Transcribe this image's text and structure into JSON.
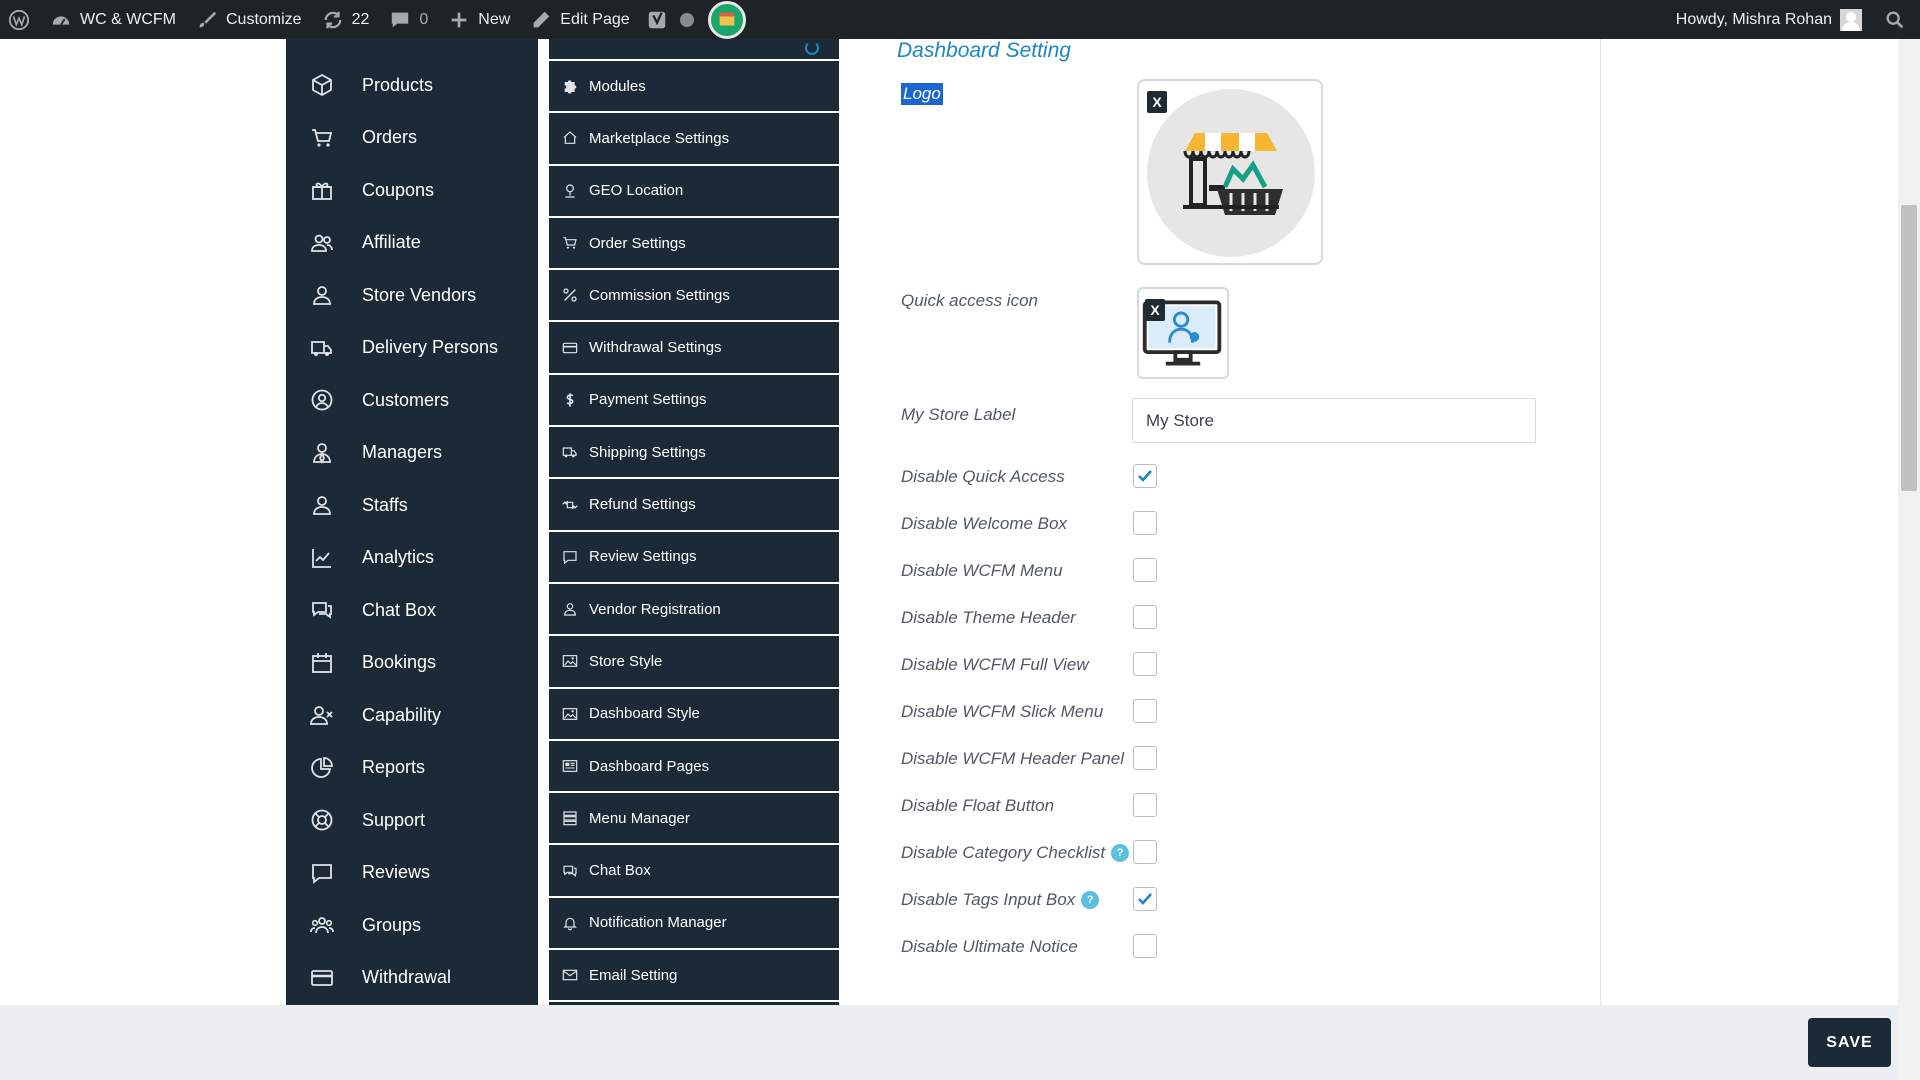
{
  "adminbar": {
    "site_name": "WC & WCFM",
    "customize": "Customize",
    "updates_count": "22",
    "comments_count": "0",
    "new_label": "New",
    "edit_page": "Edit Page",
    "greeting": "Howdy, Mishra Rohan"
  },
  "menu1": {
    "items": [
      {
        "label": "Products",
        "icon": "box-icon"
      },
      {
        "label": "Orders",
        "icon": "cart-icon"
      },
      {
        "label": "Coupons",
        "icon": "gift-icon"
      },
      {
        "label": "Affiliate",
        "icon": "users-icon"
      },
      {
        "label": "Store Vendors",
        "icon": "user-icon"
      },
      {
        "label": "Delivery Persons",
        "icon": "truck-icon"
      },
      {
        "label": "Customers",
        "icon": "user-circle-icon"
      },
      {
        "label": "Managers",
        "icon": "user-tie-icon"
      },
      {
        "label": "Staffs",
        "icon": "user-icon"
      },
      {
        "label": "Analytics",
        "icon": "chart-line-icon"
      },
      {
        "label": "Chat Box",
        "icon": "chat-icon"
      },
      {
        "label": "Bookings",
        "icon": "calendar-icon"
      },
      {
        "label": "Capability",
        "icon": "user-x-icon"
      },
      {
        "label": "Reports",
        "icon": "pie-chart-icon"
      },
      {
        "label": "Support",
        "icon": "lifebuoy-icon"
      },
      {
        "label": "Reviews",
        "icon": "comment-icon"
      },
      {
        "label": "Groups",
        "icon": "group-icon"
      },
      {
        "label": "Withdrawal",
        "icon": "credit-card-icon"
      }
    ]
  },
  "menu2": {
    "items": [
      {
        "label": "Modules",
        "icon": "puzzle-icon"
      },
      {
        "label": "Marketplace Settings",
        "icon": "home-icon"
      },
      {
        "label": "GEO Location",
        "icon": "map-marker-icon"
      },
      {
        "label": "Order Settings",
        "icon": "cart-icon"
      },
      {
        "label": "Commission Settings",
        "icon": "percent-icon"
      },
      {
        "label": "Withdrawal Settings",
        "icon": "credit-card-icon"
      },
      {
        "label": "Payment Settings",
        "icon": "dollar-icon"
      },
      {
        "label": "Shipping Settings",
        "icon": "truck-icon"
      },
      {
        "label": "Refund Settings",
        "icon": "retweet-icon"
      },
      {
        "label": "Review Settings",
        "icon": "comment-icon"
      },
      {
        "label": "Vendor Registration",
        "icon": "user-icon"
      },
      {
        "label": "Store Style",
        "icon": "image-icon"
      },
      {
        "label": "Dashboard Style",
        "icon": "image-icon"
      },
      {
        "label": "Dashboard Pages",
        "icon": "newspaper-icon"
      },
      {
        "label": "Menu Manager",
        "icon": "server-icon"
      },
      {
        "label": "Chat Box",
        "icon": "chat-icon"
      },
      {
        "label": "Notification Manager",
        "icon": "bell-icon"
      },
      {
        "label": "Email Setting",
        "icon": "envelope-icon"
      }
    ]
  },
  "content": {
    "title": "Dashboard Setting",
    "logo_label": "Logo",
    "quick_access_label": "Quick access icon",
    "store_label": "My Store Label",
    "store_value": "My Store",
    "remove_label": "X",
    "checkboxes": [
      {
        "label": "Disable Quick Access",
        "checked": true
      },
      {
        "label": "Disable Welcome Box",
        "checked": false
      },
      {
        "label": "Disable WCFM Menu",
        "checked": false
      },
      {
        "label": "Disable Theme Header",
        "checked": false
      },
      {
        "label": "Disable WCFM Full View",
        "checked": false
      },
      {
        "label": "Disable WCFM Slick Menu",
        "checked": false
      },
      {
        "label": "Disable WCFM Header Panel",
        "checked": false
      },
      {
        "label": "Disable Float Button",
        "checked": false
      },
      {
        "label": "Disable Category Checklist",
        "checked": false,
        "help": true
      },
      {
        "label": "Disable Tags Input Box",
        "checked": true,
        "help": true
      },
      {
        "label": "Disable Ultimate Notice",
        "checked": false
      }
    ],
    "help_glyph": "?"
  },
  "footer": {
    "save_label": "SAVE"
  },
  "colors": {
    "sidebar": "#1b2a36",
    "accent": "#1c86c7",
    "check": "#1c86c7"
  }
}
